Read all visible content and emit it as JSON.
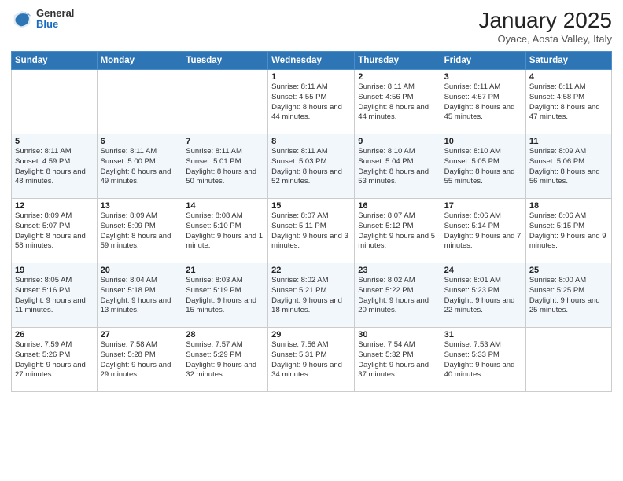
{
  "header": {
    "logo_general": "General",
    "logo_blue": "Blue",
    "month_title": "January 2025",
    "location": "Oyace, Aosta Valley, Italy"
  },
  "days_of_week": [
    "Sunday",
    "Monday",
    "Tuesday",
    "Wednesday",
    "Thursday",
    "Friday",
    "Saturday"
  ],
  "weeks": [
    [
      {
        "num": "",
        "info": ""
      },
      {
        "num": "",
        "info": ""
      },
      {
        "num": "",
        "info": ""
      },
      {
        "num": "1",
        "info": "Sunrise: 8:11 AM\nSunset: 4:55 PM\nDaylight: 8 hours\nand 44 minutes."
      },
      {
        "num": "2",
        "info": "Sunrise: 8:11 AM\nSunset: 4:56 PM\nDaylight: 8 hours\nand 44 minutes."
      },
      {
        "num": "3",
        "info": "Sunrise: 8:11 AM\nSunset: 4:57 PM\nDaylight: 8 hours\nand 45 minutes."
      },
      {
        "num": "4",
        "info": "Sunrise: 8:11 AM\nSunset: 4:58 PM\nDaylight: 8 hours\nand 47 minutes."
      }
    ],
    [
      {
        "num": "5",
        "info": "Sunrise: 8:11 AM\nSunset: 4:59 PM\nDaylight: 8 hours\nand 48 minutes."
      },
      {
        "num": "6",
        "info": "Sunrise: 8:11 AM\nSunset: 5:00 PM\nDaylight: 8 hours\nand 49 minutes."
      },
      {
        "num": "7",
        "info": "Sunrise: 8:11 AM\nSunset: 5:01 PM\nDaylight: 8 hours\nand 50 minutes."
      },
      {
        "num": "8",
        "info": "Sunrise: 8:11 AM\nSunset: 5:03 PM\nDaylight: 8 hours\nand 52 minutes."
      },
      {
        "num": "9",
        "info": "Sunrise: 8:10 AM\nSunset: 5:04 PM\nDaylight: 8 hours\nand 53 minutes."
      },
      {
        "num": "10",
        "info": "Sunrise: 8:10 AM\nSunset: 5:05 PM\nDaylight: 8 hours\nand 55 minutes."
      },
      {
        "num": "11",
        "info": "Sunrise: 8:09 AM\nSunset: 5:06 PM\nDaylight: 8 hours\nand 56 minutes."
      }
    ],
    [
      {
        "num": "12",
        "info": "Sunrise: 8:09 AM\nSunset: 5:07 PM\nDaylight: 8 hours\nand 58 minutes."
      },
      {
        "num": "13",
        "info": "Sunrise: 8:09 AM\nSunset: 5:09 PM\nDaylight: 8 hours\nand 59 minutes."
      },
      {
        "num": "14",
        "info": "Sunrise: 8:08 AM\nSunset: 5:10 PM\nDaylight: 9 hours\nand 1 minute."
      },
      {
        "num": "15",
        "info": "Sunrise: 8:07 AM\nSunset: 5:11 PM\nDaylight: 9 hours\nand 3 minutes."
      },
      {
        "num": "16",
        "info": "Sunrise: 8:07 AM\nSunset: 5:12 PM\nDaylight: 9 hours\nand 5 minutes."
      },
      {
        "num": "17",
        "info": "Sunrise: 8:06 AM\nSunset: 5:14 PM\nDaylight: 9 hours\nand 7 minutes."
      },
      {
        "num": "18",
        "info": "Sunrise: 8:06 AM\nSunset: 5:15 PM\nDaylight: 9 hours\nand 9 minutes."
      }
    ],
    [
      {
        "num": "19",
        "info": "Sunrise: 8:05 AM\nSunset: 5:16 PM\nDaylight: 9 hours\nand 11 minutes."
      },
      {
        "num": "20",
        "info": "Sunrise: 8:04 AM\nSunset: 5:18 PM\nDaylight: 9 hours\nand 13 minutes."
      },
      {
        "num": "21",
        "info": "Sunrise: 8:03 AM\nSunset: 5:19 PM\nDaylight: 9 hours\nand 15 minutes."
      },
      {
        "num": "22",
        "info": "Sunrise: 8:02 AM\nSunset: 5:21 PM\nDaylight: 9 hours\nand 18 minutes."
      },
      {
        "num": "23",
        "info": "Sunrise: 8:02 AM\nSunset: 5:22 PM\nDaylight: 9 hours\nand 20 minutes."
      },
      {
        "num": "24",
        "info": "Sunrise: 8:01 AM\nSunset: 5:23 PM\nDaylight: 9 hours\nand 22 minutes."
      },
      {
        "num": "25",
        "info": "Sunrise: 8:00 AM\nSunset: 5:25 PM\nDaylight: 9 hours\nand 25 minutes."
      }
    ],
    [
      {
        "num": "26",
        "info": "Sunrise: 7:59 AM\nSunset: 5:26 PM\nDaylight: 9 hours\nand 27 minutes."
      },
      {
        "num": "27",
        "info": "Sunrise: 7:58 AM\nSunset: 5:28 PM\nDaylight: 9 hours\nand 29 minutes."
      },
      {
        "num": "28",
        "info": "Sunrise: 7:57 AM\nSunset: 5:29 PM\nDaylight: 9 hours\nand 32 minutes."
      },
      {
        "num": "29",
        "info": "Sunrise: 7:56 AM\nSunset: 5:31 PM\nDaylight: 9 hours\nand 34 minutes."
      },
      {
        "num": "30",
        "info": "Sunrise: 7:54 AM\nSunset: 5:32 PM\nDaylight: 9 hours\nand 37 minutes."
      },
      {
        "num": "31",
        "info": "Sunrise: 7:53 AM\nSunset: 5:33 PM\nDaylight: 9 hours\nand 40 minutes."
      },
      {
        "num": "",
        "info": ""
      }
    ]
  ]
}
